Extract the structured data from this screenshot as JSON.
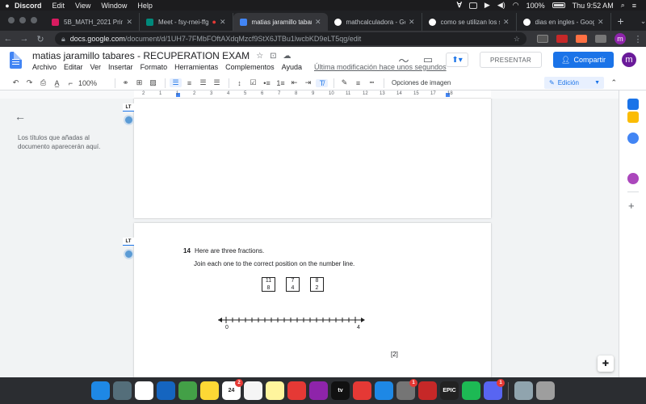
{
  "mac_menubar": {
    "app": "Discord",
    "menus": [
      "Edit",
      "View",
      "Window",
      "Help"
    ],
    "battery": "100%",
    "clock": "Thu 9:52 AM"
  },
  "browser": {
    "tabs": [
      {
        "title": "5B_MATH_2021 Primary",
        "icon_color": "#d81b60",
        "active": false
      },
      {
        "title": "Meet - fsy-rnei-ffg",
        "icon_color": "#00897b",
        "active": false
      },
      {
        "title": "matias jaramillo tabares",
        "icon_color": "#4285f4",
        "active": true
      },
      {
        "title": "mathcalculadora - Goog",
        "icon_color": "#ffffff",
        "active": false
      },
      {
        "title": "como se utilizan los sign",
        "icon_color": "#ffffff",
        "active": false
      },
      {
        "title": "dias en ingles - Google B",
        "icon_color": "#ffffff",
        "active": false
      }
    ],
    "new_tab": "+",
    "url_host": "docs.google.com",
    "url_path": "/document/d/1UH7-7FMbFOftAXdqMzcf9StX6JTBu1lwcbKD9eLT5qg/edit",
    "profile_initial": "m"
  },
  "docs": {
    "title": "matias jaramillo tabares - RECUPERATION EXAM",
    "menu": [
      "Archivo",
      "Editar",
      "Ver",
      "Insertar",
      "Formato",
      "Herramientas",
      "Complementos",
      "Ayuda"
    ],
    "last_modified": "Última modificación hace unos segundos",
    "present_label": "PRESENTAR",
    "share_label": "Compartir",
    "user_initial": "m",
    "zoom": "100%",
    "image_options": "Opciones de imagen",
    "mode": "Edición"
  },
  "ruler": {
    "ticks": [
      "2",
      "1",
      "1",
      "2",
      "3",
      "4",
      "5",
      "6",
      "7",
      "8",
      "9",
      "10",
      "11",
      "12",
      "13",
      "14",
      "15",
      "17",
      "18"
    ]
  },
  "outline": {
    "placeholder": "Los títulos que añadas al documento aparecerán aquí."
  },
  "question": {
    "number": "14",
    "line1": "Here are three fractions.",
    "line2": "Join each one to the correct position on the number line.",
    "fractions": [
      {
        "numerator": "11",
        "denominator": "8"
      },
      {
        "numerator": "7",
        "denominator": "4"
      },
      {
        "numerator": "8",
        "denominator": "2"
      }
    ],
    "numberline_start": "0",
    "numberline_end": "4",
    "numberline_ticks": 20,
    "marks": "[2]"
  },
  "badges": {
    "lt": "LT"
  },
  "dock": {
    "apps": [
      {
        "name": "finder",
        "color": "#1e88e5",
        "badge": ""
      },
      {
        "name": "launchpad",
        "color": "#546e7a",
        "badge": ""
      },
      {
        "name": "chrome",
        "color": "#ffffff",
        "badge": ""
      },
      {
        "name": "safari",
        "color": "#1565c0",
        "badge": ""
      },
      {
        "name": "messages",
        "color": "#43a047",
        "badge": ""
      },
      {
        "name": "photos",
        "color": "#fdd835",
        "badge": ""
      },
      {
        "name": "calendar",
        "color": "#ffffff",
        "badge": "2",
        "label": "24"
      },
      {
        "name": "reminders",
        "color": "#f5f5f5",
        "badge": ""
      },
      {
        "name": "notes",
        "color": "#fff59d",
        "badge": ""
      },
      {
        "name": "music",
        "color": "#e53935",
        "badge": ""
      },
      {
        "name": "podcasts",
        "color": "#8e24aa",
        "badge": ""
      },
      {
        "name": "tv",
        "color": "#111111",
        "badge": "",
        "label": "tv"
      },
      {
        "name": "news",
        "color": "#e53935",
        "badge": ""
      },
      {
        "name": "app-store",
        "color": "#1e88e5",
        "badge": ""
      },
      {
        "name": "system-preferences",
        "color": "#757575",
        "badge": "1"
      },
      {
        "name": "express-vpn",
        "color": "#c62828",
        "badge": ""
      },
      {
        "name": "epic-games",
        "color": "#222222",
        "badge": "",
        "label": "EPIC"
      },
      {
        "name": "spotify",
        "color": "#1db954",
        "badge": ""
      },
      {
        "name": "discord",
        "color": "#5865f2",
        "badge": "1"
      },
      {
        "name": "downloads",
        "color": "#90a4ae",
        "badge": ""
      },
      {
        "name": "trash",
        "color": "#9e9e9e",
        "badge": ""
      }
    ]
  }
}
